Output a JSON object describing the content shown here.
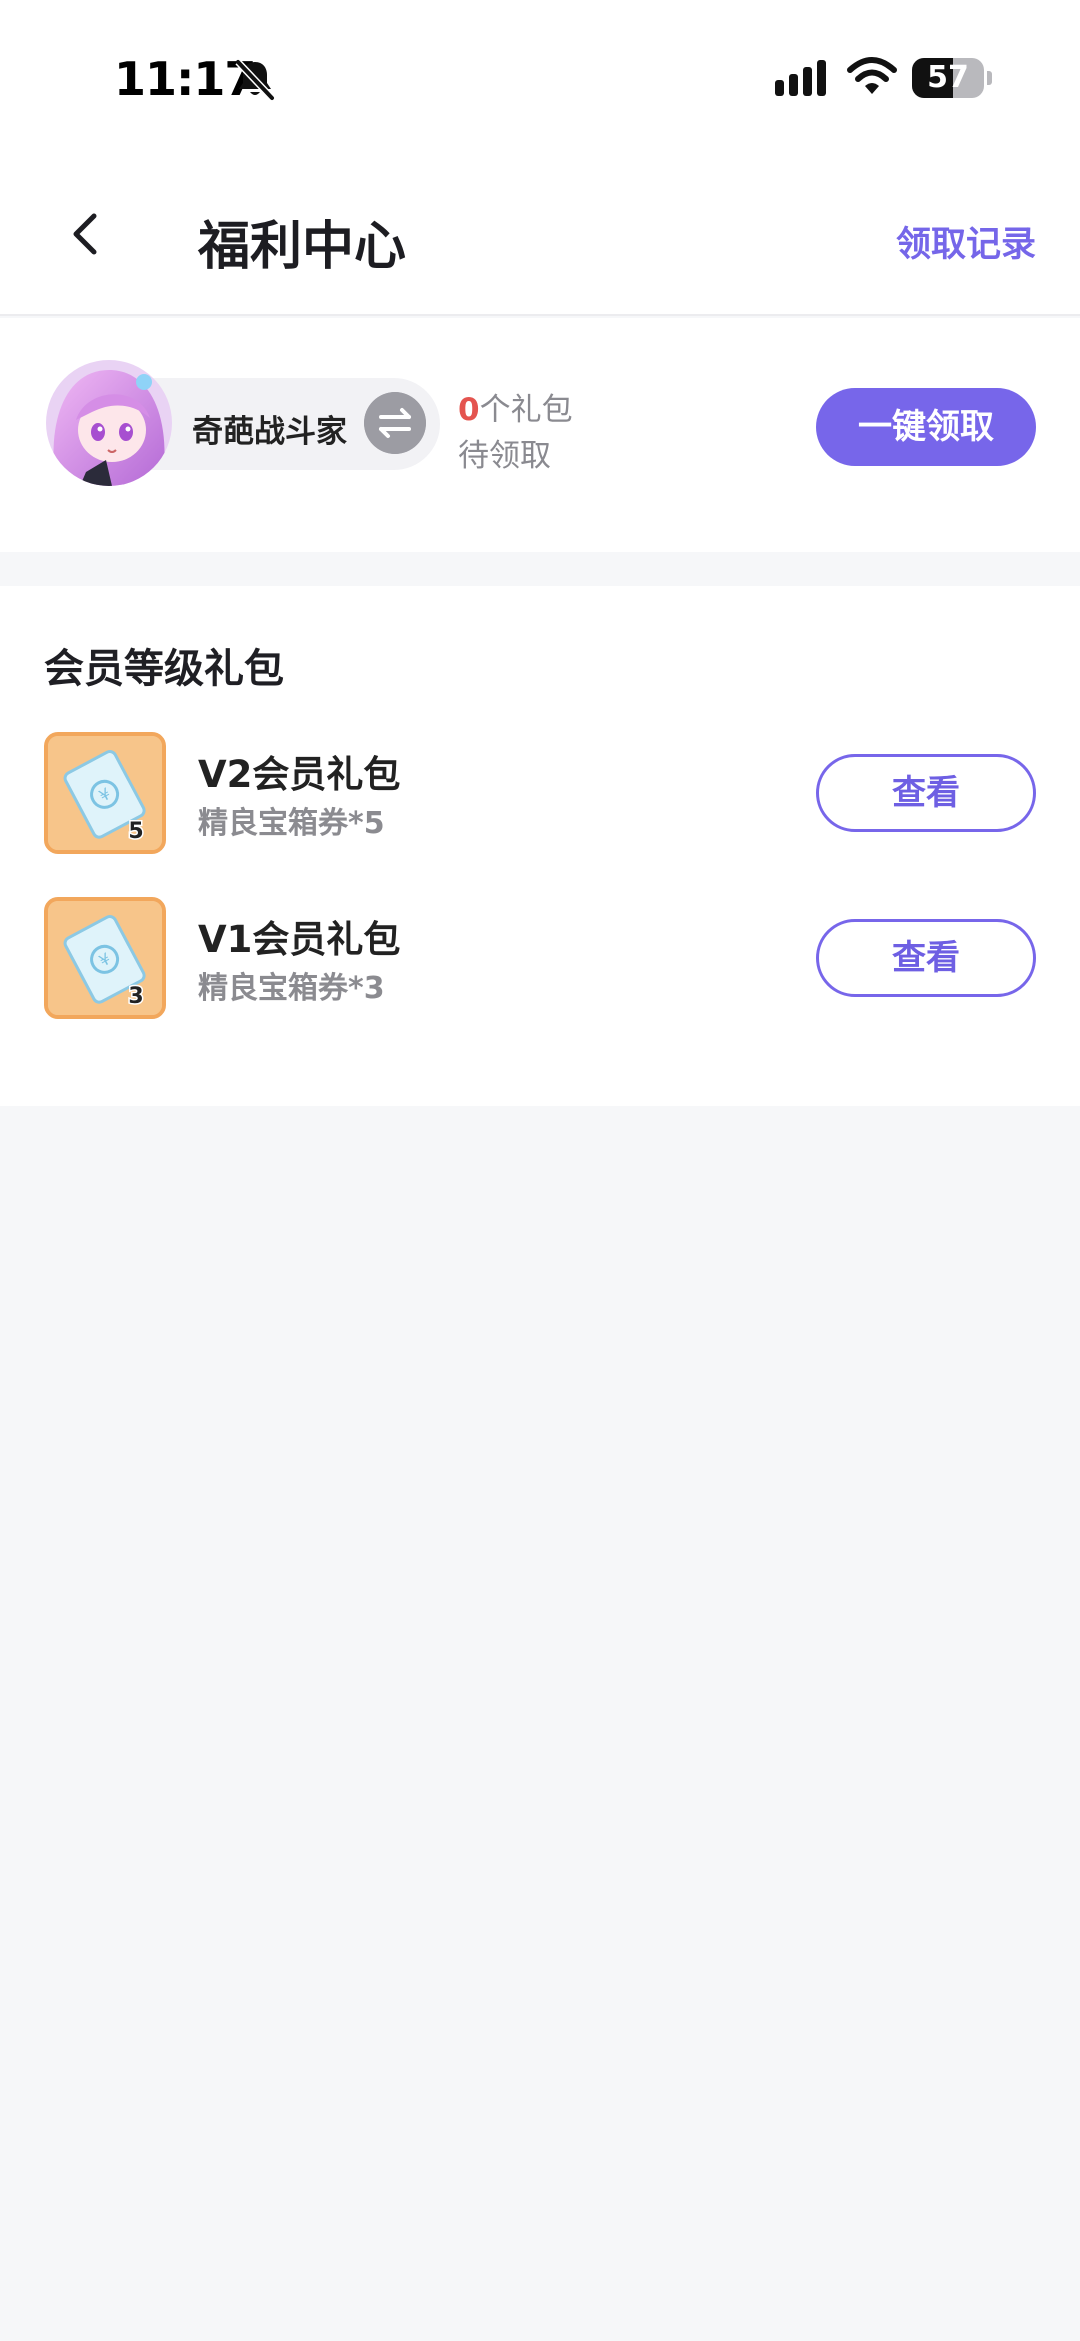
{
  "status_bar": {
    "time": "11:17",
    "battery_level": "57",
    "battery_fraction": 0.57,
    "icons": [
      "bell-muted-icon",
      "cellular-signal-icon",
      "wifi-icon",
      "battery-icon"
    ]
  },
  "nav": {
    "title": "福利中心",
    "record_link": "领取记录",
    "back_icon": "chevron-left-icon"
  },
  "account": {
    "username": "奇葩战斗家",
    "gift_count": "0",
    "gift_count_suffix": "个礼包",
    "pending_label": "待领取",
    "claim_all_label": "一键领取",
    "swap_icon": "swap-arrows-icon"
  },
  "gift_section": {
    "title": "会员等级礼包",
    "items": [
      {
        "name": "V2会员礼包",
        "desc": "精良宝箱券*5",
        "badge": "5",
        "button": "查看"
      },
      {
        "name": "V1会员礼包",
        "desc": "精良宝箱券*3",
        "badge": "3",
        "button": "查看"
      }
    ]
  },
  "colors": {
    "accent": "#7766ea",
    "count_red": "#e4544f",
    "icon_bg": "#f7c58a",
    "page_bg": "#f6f7f9"
  }
}
